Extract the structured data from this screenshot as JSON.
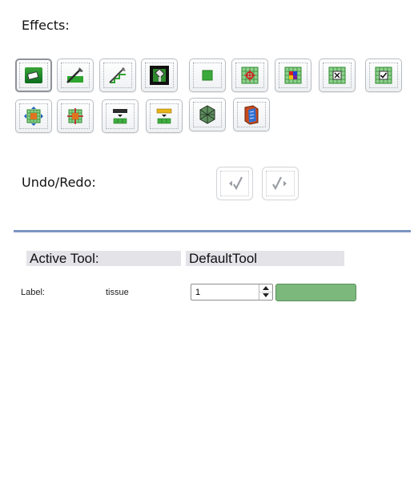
{
  "effects": {
    "label": "Effects:",
    "tools": [
      {
        "name": "eraser-icon"
      },
      {
        "name": "brush-icon"
      },
      {
        "name": "staircase-icon"
      },
      {
        "name": "fill-icon"
      },
      {
        "name": "threshold-icon"
      },
      {
        "name": "target-grid-icon"
      },
      {
        "name": "color-grid-icon"
      },
      {
        "name": "clear-grid-icon"
      },
      {
        "name": "check-grid-icon"
      },
      {
        "name": "expand-grid-icon"
      },
      {
        "name": "shrink-grid-icon"
      },
      {
        "name": "slice-down-icon"
      },
      {
        "name": "slice-up-icon"
      },
      {
        "name": "mesh-icon"
      },
      {
        "name": "book-icon"
      }
    ]
  },
  "undo_redo": {
    "label": "Undo/Redo:",
    "undo_icon": "undo-icon",
    "redo_icon": "redo-icon"
  },
  "active_tool": {
    "label": "Active Tool:",
    "value": "DefaultTool"
  },
  "label_row": {
    "label": "Label:",
    "name": "tissue",
    "value": "1",
    "color": "#7cb87c"
  }
}
